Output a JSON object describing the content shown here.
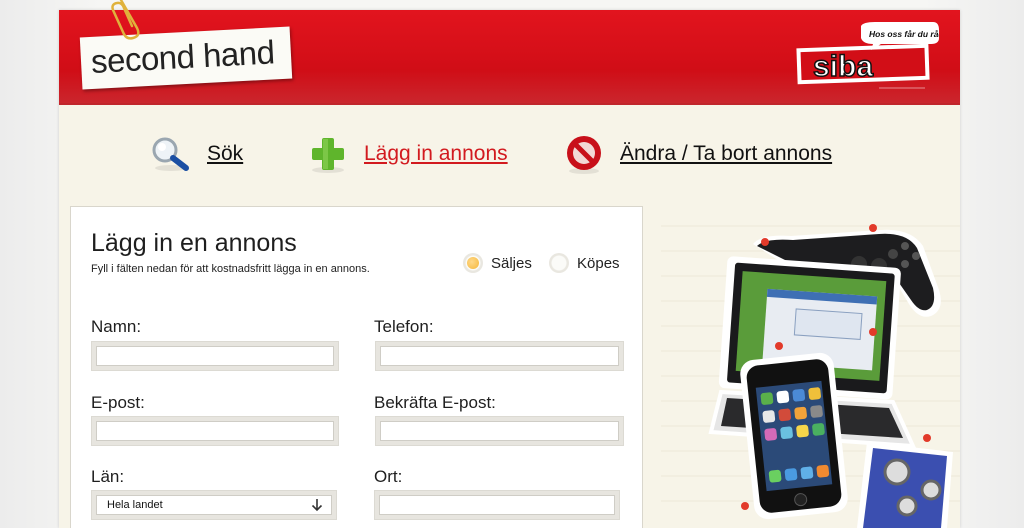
{
  "header": {
    "logo_text": "second hand",
    "brand": "siba",
    "brand_slogan": "Hos oss får du råd"
  },
  "nav": {
    "items": [
      {
        "label": "Sök",
        "icon": "search-icon"
      },
      {
        "label": "Lägg in annons",
        "icon": "plus-icon",
        "active": true
      },
      {
        "label": "Ändra / Ta bort annons",
        "icon": "no-entry-icon"
      }
    ]
  },
  "form": {
    "title": "Lägg in en annons",
    "subtitle": "Fyll i fälten nedan för att kostnadsfritt lägga in en annons.",
    "radios": [
      {
        "label": "Säljes",
        "selected": true
      },
      {
        "label": "Köpes",
        "selected": false
      }
    ],
    "fields": {
      "name_label": "Namn:",
      "name_value": "",
      "phone_label": "Telefon:",
      "phone_value": "",
      "email_label": "E-post:",
      "email_value": "",
      "confirm_email_label": "Bekräfta E-post:",
      "confirm_email_value": "",
      "county_label": "Län:",
      "county_value": "Hela landet",
      "city_label": "Ort:",
      "city_value": ""
    }
  },
  "colors": {
    "header_red": "#d20e17",
    "active_link": "#d21a1f",
    "page_bg": "#f7f4e8"
  }
}
